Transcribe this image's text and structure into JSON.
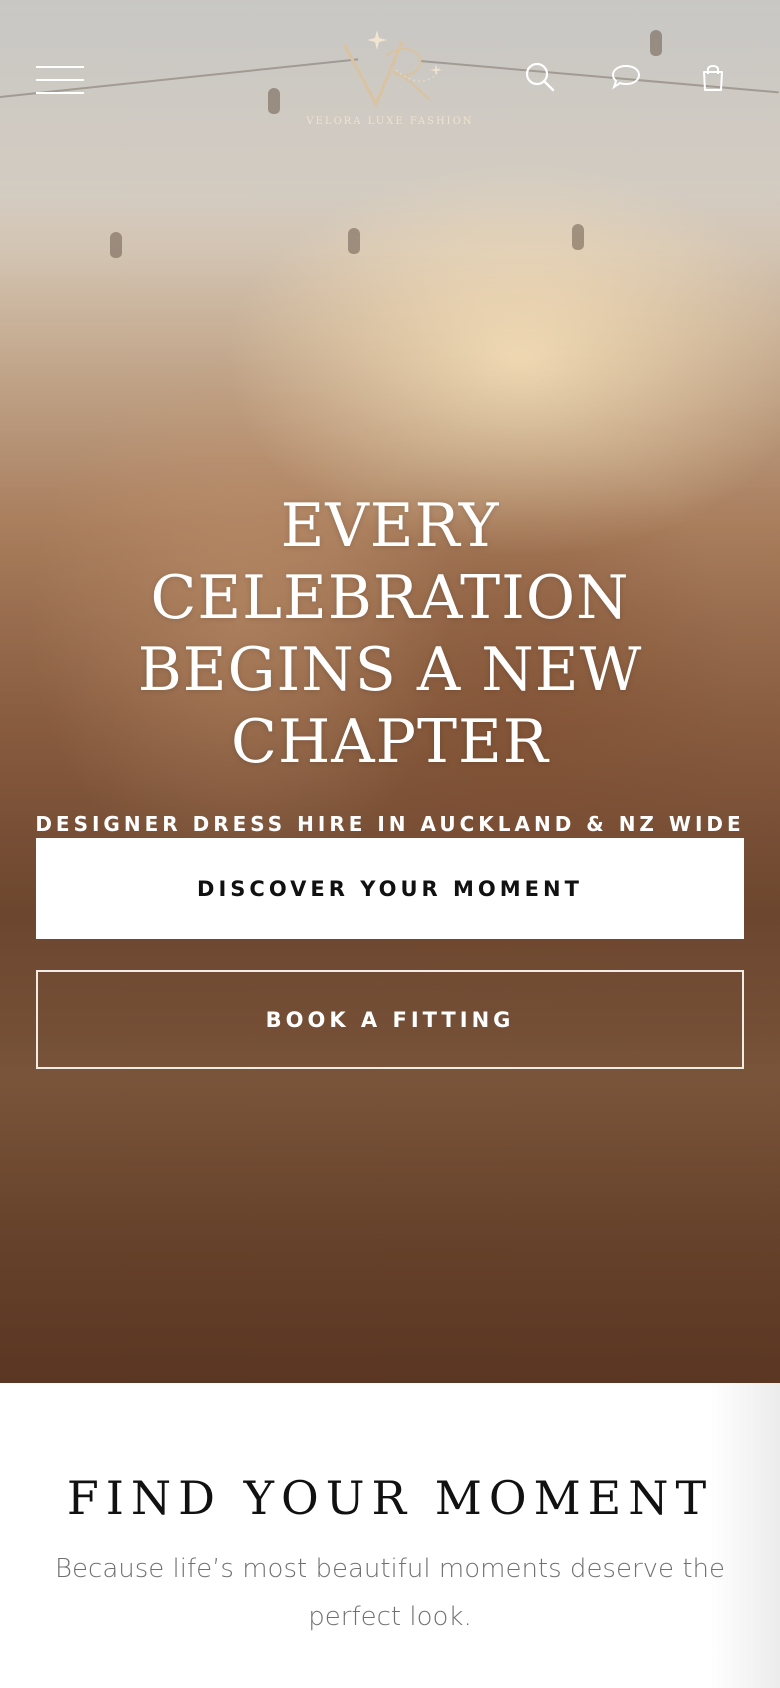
{
  "header": {
    "logo_text": "VELORA LUXE FASHION",
    "menu_icon": "hamburger-menu-icon",
    "search_icon": "search-icon",
    "chat_icon": "chat-bubble-icon",
    "cart_icon": "shopping-bag-icon"
  },
  "hero": {
    "title": "EVERY CELEBRATION BEGINS A NEW CHAPTER",
    "subtitle": "DESIGNER DRESS HIRE IN AUCKLAND & NZ WIDE",
    "primary_button": "DISCOVER YOUR MOMENT",
    "secondary_button": "BOOK A FITTING"
  },
  "section": {
    "title": "FIND YOUR MOMENT",
    "text": "Because life’s most beautiful moments deserve the perfect look."
  },
  "colors": {
    "accent_gold": "#d9c3a0",
    "button_bg": "#ffffff",
    "title_text": "#111111",
    "body_text": "#707070"
  }
}
